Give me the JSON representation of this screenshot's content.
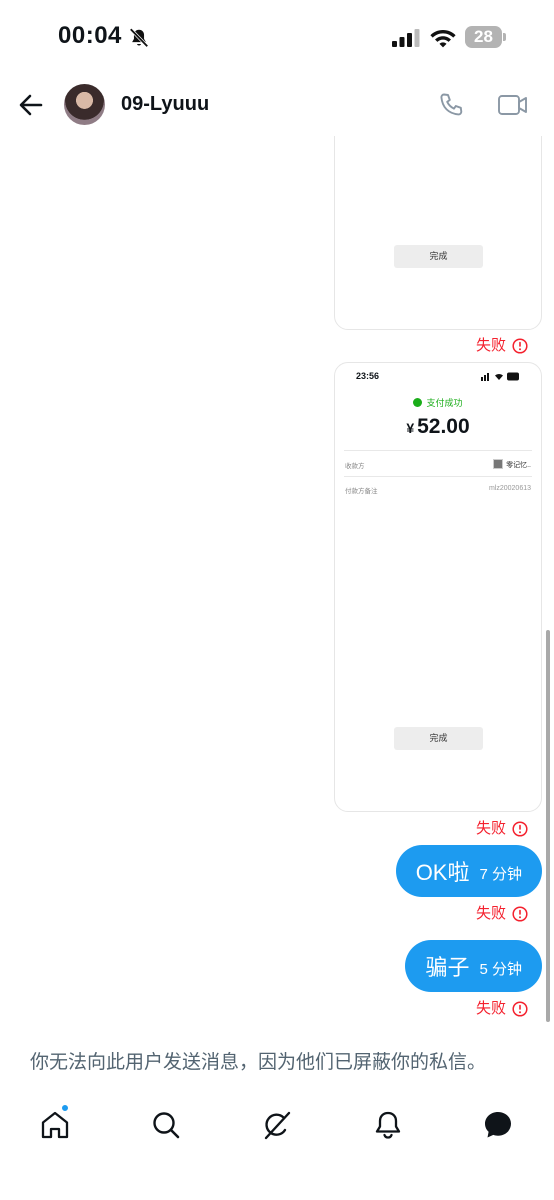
{
  "status_bar": {
    "time": "00:04",
    "battery": "28"
  },
  "header": {
    "username": "09-Lyuuu"
  },
  "messages": {
    "card1": {
      "done_label": "完成",
      "status": "失败"
    },
    "card2": {
      "time": "23:56",
      "pay_status": "支付成功",
      "currency": "¥",
      "amount": "52.00",
      "payee_label": "收款方",
      "payee_value": "零记忆..",
      "note_label": "付款方备注",
      "note_value": "mlz20020613",
      "done_label": "完成",
      "status": "失败"
    },
    "bubble1": {
      "text": "OK啦",
      "time": "7 分钟",
      "status": "失败"
    },
    "bubble2": {
      "text": "骗子",
      "time": "5 分钟",
      "status": "失败"
    }
  },
  "footer": {
    "blocked_notice": "你无法向此用户发送消息，因为他们已屏蔽你的私信。"
  },
  "colors": {
    "accent": "#1d9bf0",
    "error": "#f4212e",
    "muted": "#536471"
  },
  "icons": [
    "bell-slash-icon",
    "signal-icon",
    "wifi-icon",
    "battery-icon",
    "back-arrow-icon",
    "phone-icon",
    "video-camera-icon",
    "info-circle-icon",
    "home-icon",
    "search-icon",
    "grok-icon",
    "bell-icon",
    "messages-icon"
  ]
}
